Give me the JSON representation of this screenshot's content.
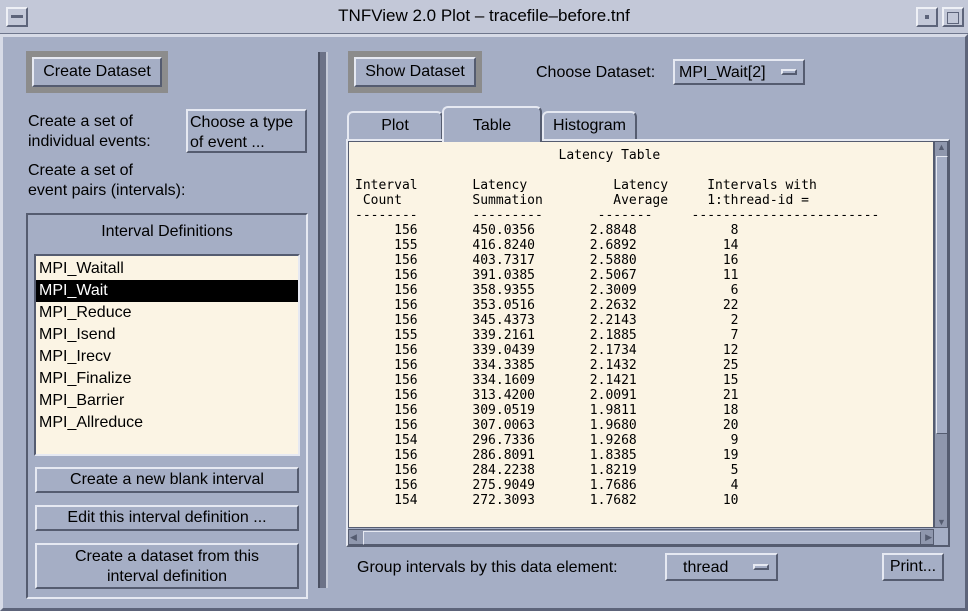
{
  "window": {
    "title": "TNFView 2.0 Plot – tracefile–before.tnf"
  },
  "left": {
    "create_dataset_label": "Create Dataset",
    "individual_events_line1": "Create a set of",
    "individual_events_line2": "individual events:",
    "choose_type_line1": "Choose a type",
    "choose_type_line2": "of event ...",
    "event_pairs_line1": "Create a set of",
    "event_pairs_line2": "event pairs (intervals):",
    "interval_definitions_title": "Interval Definitions",
    "intervals": [
      "MPI_Waitall",
      "MPI_Wait",
      "MPI_Reduce",
      "MPI_Isend",
      "MPI_Irecv",
      "MPI_Finalize",
      "MPI_Barrier",
      "MPI_Allreduce"
    ],
    "selected_interval": "MPI_Wait",
    "new_blank_interval": "Create a new blank interval",
    "edit_interval": "Edit this interval definition ...",
    "create_from_line1": "Create a dataset from this",
    "create_from_line2": "interval definition"
  },
  "right": {
    "show_dataset_label": "Show Dataset",
    "choose_dataset_label": "Choose Dataset:",
    "dataset_value": "MPI_Wait[2]",
    "tabs": [
      {
        "label": "Plot"
      },
      {
        "label": "Table"
      },
      {
        "label": "Histogram"
      }
    ],
    "active_tab": "Table",
    "group_label": "Group intervals by this data element:",
    "group_value": "thread",
    "print_label": "Print..."
  },
  "table": {
    "title": "Latency Table",
    "header_line1": [
      "Interval",
      "Latency",
      "Latency",
      "Intervals with"
    ],
    "header_line2": [
      "Count",
      "Summation",
      "Average",
      "1:thread-id ="
    ],
    "rows": [
      [
        "156",
        "450.0356",
        "2.8848",
        "8"
      ],
      [
        "155",
        "416.8240",
        "2.6892",
        "14"
      ],
      [
        "156",
        "403.7317",
        "2.5880",
        "16"
      ],
      [
        "156",
        "391.0385",
        "2.5067",
        "11"
      ],
      [
        "156",
        "358.9355",
        "2.3009",
        "6"
      ],
      [
        "156",
        "353.0516",
        "2.2632",
        "22"
      ],
      [
        "156",
        "345.4373",
        "2.2143",
        "2"
      ],
      [
        "155",
        "339.2161",
        "2.1885",
        "7"
      ],
      [
        "156",
        "339.0439",
        "2.1734",
        "12"
      ],
      [
        "156",
        "334.3385",
        "2.1432",
        "25"
      ],
      [
        "156",
        "334.1609",
        "2.1421",
        "15"
      ],
      [
        "156",
        "313.4200",
        "2.0091",
        "21"
      ],
      [
        "156",
        "309.0519",
        "1.9811",
        "18"
      ],
      [
        "156",
        "307.0063",
        "1.9680",
        "20"
      ],
      [
        "154",
        "296.7336",
        "1.9268",
        "9"
      ],
      [
        "156",
        "286.8091",
        "1.8385",
        "19"
      ],
      [
        "156",
        "284.2238",
        "1.8219",
        "5"
      ],
      [
        "156",
        "275.9049",
        "1.7686",
        "4"
      ],
      [
        "154",
        "272.3093",
        "1.7682",
        "10"
      ]
    ]
  }
}
